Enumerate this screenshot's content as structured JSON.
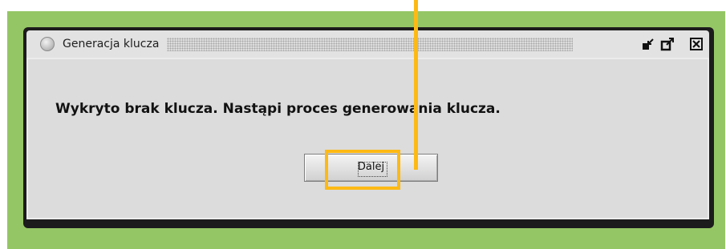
{
  "window": {
    "title": "Generacja klucza",
    "message": "Wykryto brak klucza. Nastąpi proces generowania klucza.",
    "next_button_label": "Dalej"
  },
  "title_controls": [
    "minimize-icon",
    "maximize-icon",
    "close-icon"
  ],
  "colors": {
    "background_frame": "#95c665",
    "annotation": "#fdb914",
    "window_body": "#dcdcdc",
    "window_border": "#1c1c1c"
  }
}
